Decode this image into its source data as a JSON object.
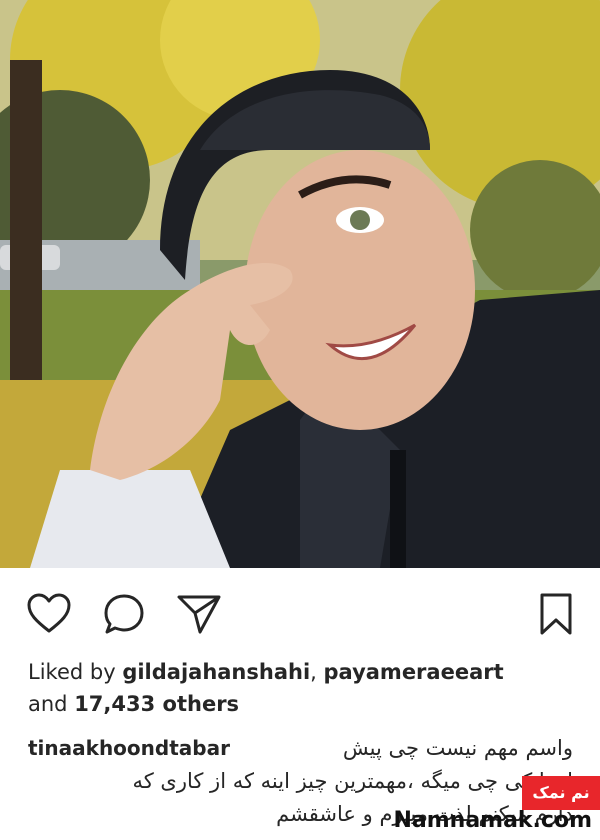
{
  "post": {
    "photo_icon": "selfie-photo",
    "actions": {
      "like_icon": "heart-icon",
      "comment_icon": "comment-icon",
      "share_icon": "send-icon",
      "save_icon": "bookmark-icon"
    },
    "likes_prefix": "Liked by ",
    "liked_by_1": "gildajahanshahi",
    "liked_by_sep": ", ",
    "liked_by_2": "payameraeeart",
    "likes_and": "and ",
    "likes_count": "17,433 others",
    "caption_user": "tinaakhoondtabar",
    "caption_line1": "واسم مهم نیست چی پیش",
    "caption_line2": "اد یا کی چی میگه ،مهمترین چیز اینه که از کاری که",
    "caption_line3": "دارم میکنم لذت میبرم  و عاشقشم"
  },
  "watermark": {
    "badge": "نم نمک",
    "url": "Namnamak.com"
  }
}
